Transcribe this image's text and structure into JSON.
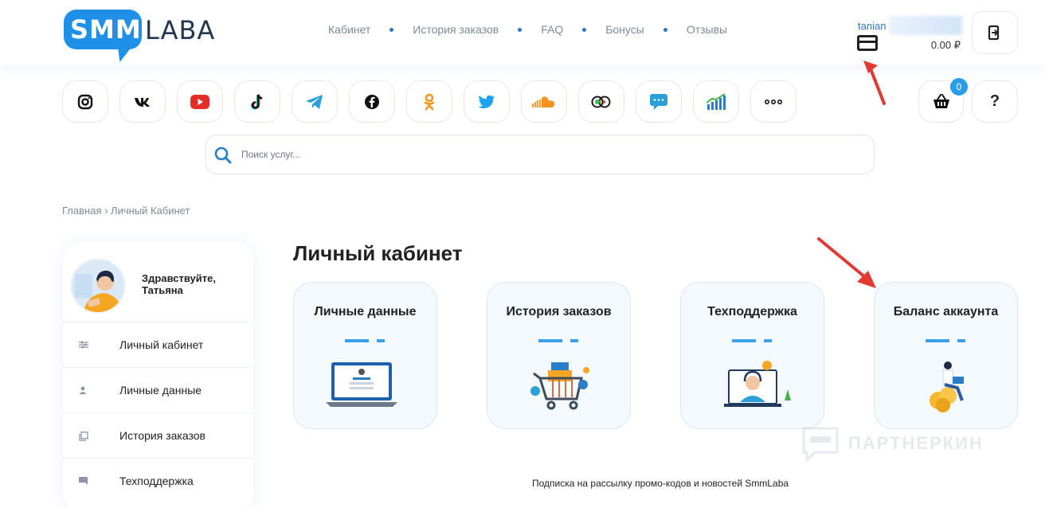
{
  "brand": {
    "logo_part1": "SMM",
    "logo_part2": "LABA"
  },
  "nav": [
    {
      "label": "Кабинет"
    },
    {
      "label": "История заказов"
    },
    {
      "label": "FAQ"
    },
    {
      "label": "Бонусы"
    },
    {
      "label": "Отзывы"
    }
  ],
  "user": {
    "name": "tanian",
    "balance": "0.00 ₽"
  },
  "socials": [
    "instagram-icon",
    "vk-icon",
    "youtube-icon",
    "tiktok-icon",
    "telegram-icon",
    "facebook-icon",
    "odnoklassniki-icon",
    "twitter-icon",
    "soundcloud-icon",
    "likee-icon",
    "chat-icon",
    "chart-icon",
    "more-icon"
  ],
  "cart": {
    "count": "0"
  },
  "help": {
    "label": "?"
  },
  "search": {
    "placeholder": "Поиск услуг..."
  },
  "breadcrumb": {
    "text": "Главная › Личный Кабинет"
  },
  "sidebar": {
    "greeting": "Здравствуйте, Татьяна",
    "items": [
      {
        "label": "Личный кабинет",
        "icon": "sliders-icon"
      },
      {
        "label": "Личные данные",
        "icon": "user-icon"
      },
      {
        "label": "История заказов",
        "icon": "copy-icon"
      },
      {
        "label": "Техподдержка",
        "icon": "chat-icon"
      }
    ]
  },
  "main": {
    "title": "Личный кабинет",
    "tiles": [
      {
        "title": "Личные данные"
      },
      {
        "title": "История заказов"
      },
      {
        "title": "Техподдержка"
      },
      {
        "title": "Баланс аккаунта"
      }
    ]
  },
  "footer": {
    "subscribe": "Подписка на рассылку промо-кодов и новостей SmmLaba"
  },
  "watermark": {
    "text": "ПАРТНЕРКИН"
  },
  "colors": {
    "accent": "#1f8fe8",
    "arrow": "#e03a32",
    "nav_text": "#7d8a99"
  }
}
